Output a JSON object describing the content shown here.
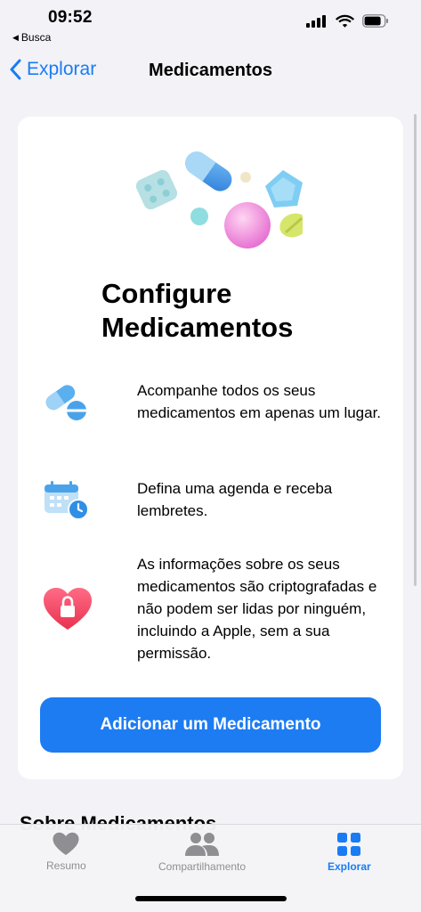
{
  "status": {
    "time": "09:52",
    "back_app": "Busca"
  },
  "nav": {
    "back_label": "Explorar",
    "title": "Medicamentos"
  },
  "card": {
    "title": "Configure Medicamentos",
    "features": [
      {
        "icon": "pills-icon",
        "text": "Acompanhe todos os seus medicamentos em apenas um lugar."
      },
      {
        "icon": "calendar-clock-icon",
        "text": "Defina uma agenda e receba lembretes."
      },
      {
        "icon": "heart-lock-icon",
        "text": "As informações sobre os seus medicamentos são criptografadas e não podem ser lidas por ninguém, incluindo a Apple, sem a sua permissão."
      }
    ],
    "cta_label": "Adicionar um Medicamento"
  },
  "peek_heading": "Sobre Medicamentos",
  "tabbar": {
    "tabs": [
      {
        "label": "Resumo",
        "icon": "heart-icon",
        "active": false
      },
      {
        "label": "Compartilhamento",
        "icon": "people-icon",
        "active": false
      },
      {
        "label": "Explorar",
        "icon": "grid-icon",
        "active": true
      }
    ]
  },
  "colors": {
    "accent": "#1a7cf5",
    "button": "#1d7cf2",
    "background": "#f2f2f7",
    "heart": "#f2415c"
  }
}
